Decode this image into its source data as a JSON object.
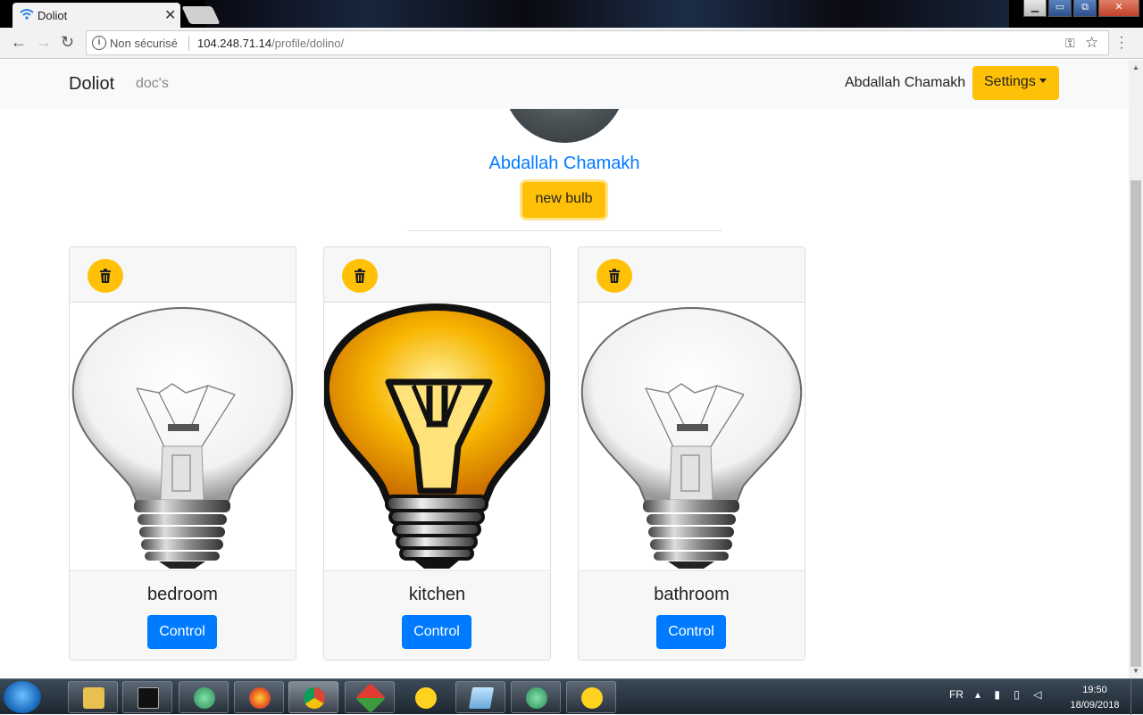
{
  "browser": {
    "tab_title": "Doliot",
    "security_label": "Non sécurisé",
    "url_host": "104.248.71.14",
    "url_path": "/profile/dolino/"
  },
  "navbar": {
    "brand": "Doliot",
    "docs_link": "doc's",
    "username": "Abdallah Chamakh",
    "settings_label": "Settings"
  },
  "profile": {
    "name": "Abdallah Chamakh",
    "new_bulb_label": "new bulb"
  },
  "bulbs": [
    {
      "name": "bedroom",
      "state": "off",
      "control_label": "Control"
    },
    {
      "name": "kitchen",
      "state": "on",
      "control_label": "Control"
    },
    {
      "name": "bathroom",
      "state": "off",
      "control_label": "Control"
    }
  ],
  "taskbar": {
    "language": "FR",
    "time": "19:50",
    "date": "18/09/2018",
    "apps": [
      "explorer-icon",
      "cmd-icon",
      "atom-icon",
      "firefox-icon",
      "chrome-icon",
      "git-icon",
      "cyberduck-icon",
      "notepad-icon",
      "atom-icon",
      "cyberduck-icon"
    ]
  },
  "colors": {
    "accent_yellow": "#ffc107",
    "primary_blue": "#007bff",
    "navbar_bg": "#f8f9fa"
  }
}
